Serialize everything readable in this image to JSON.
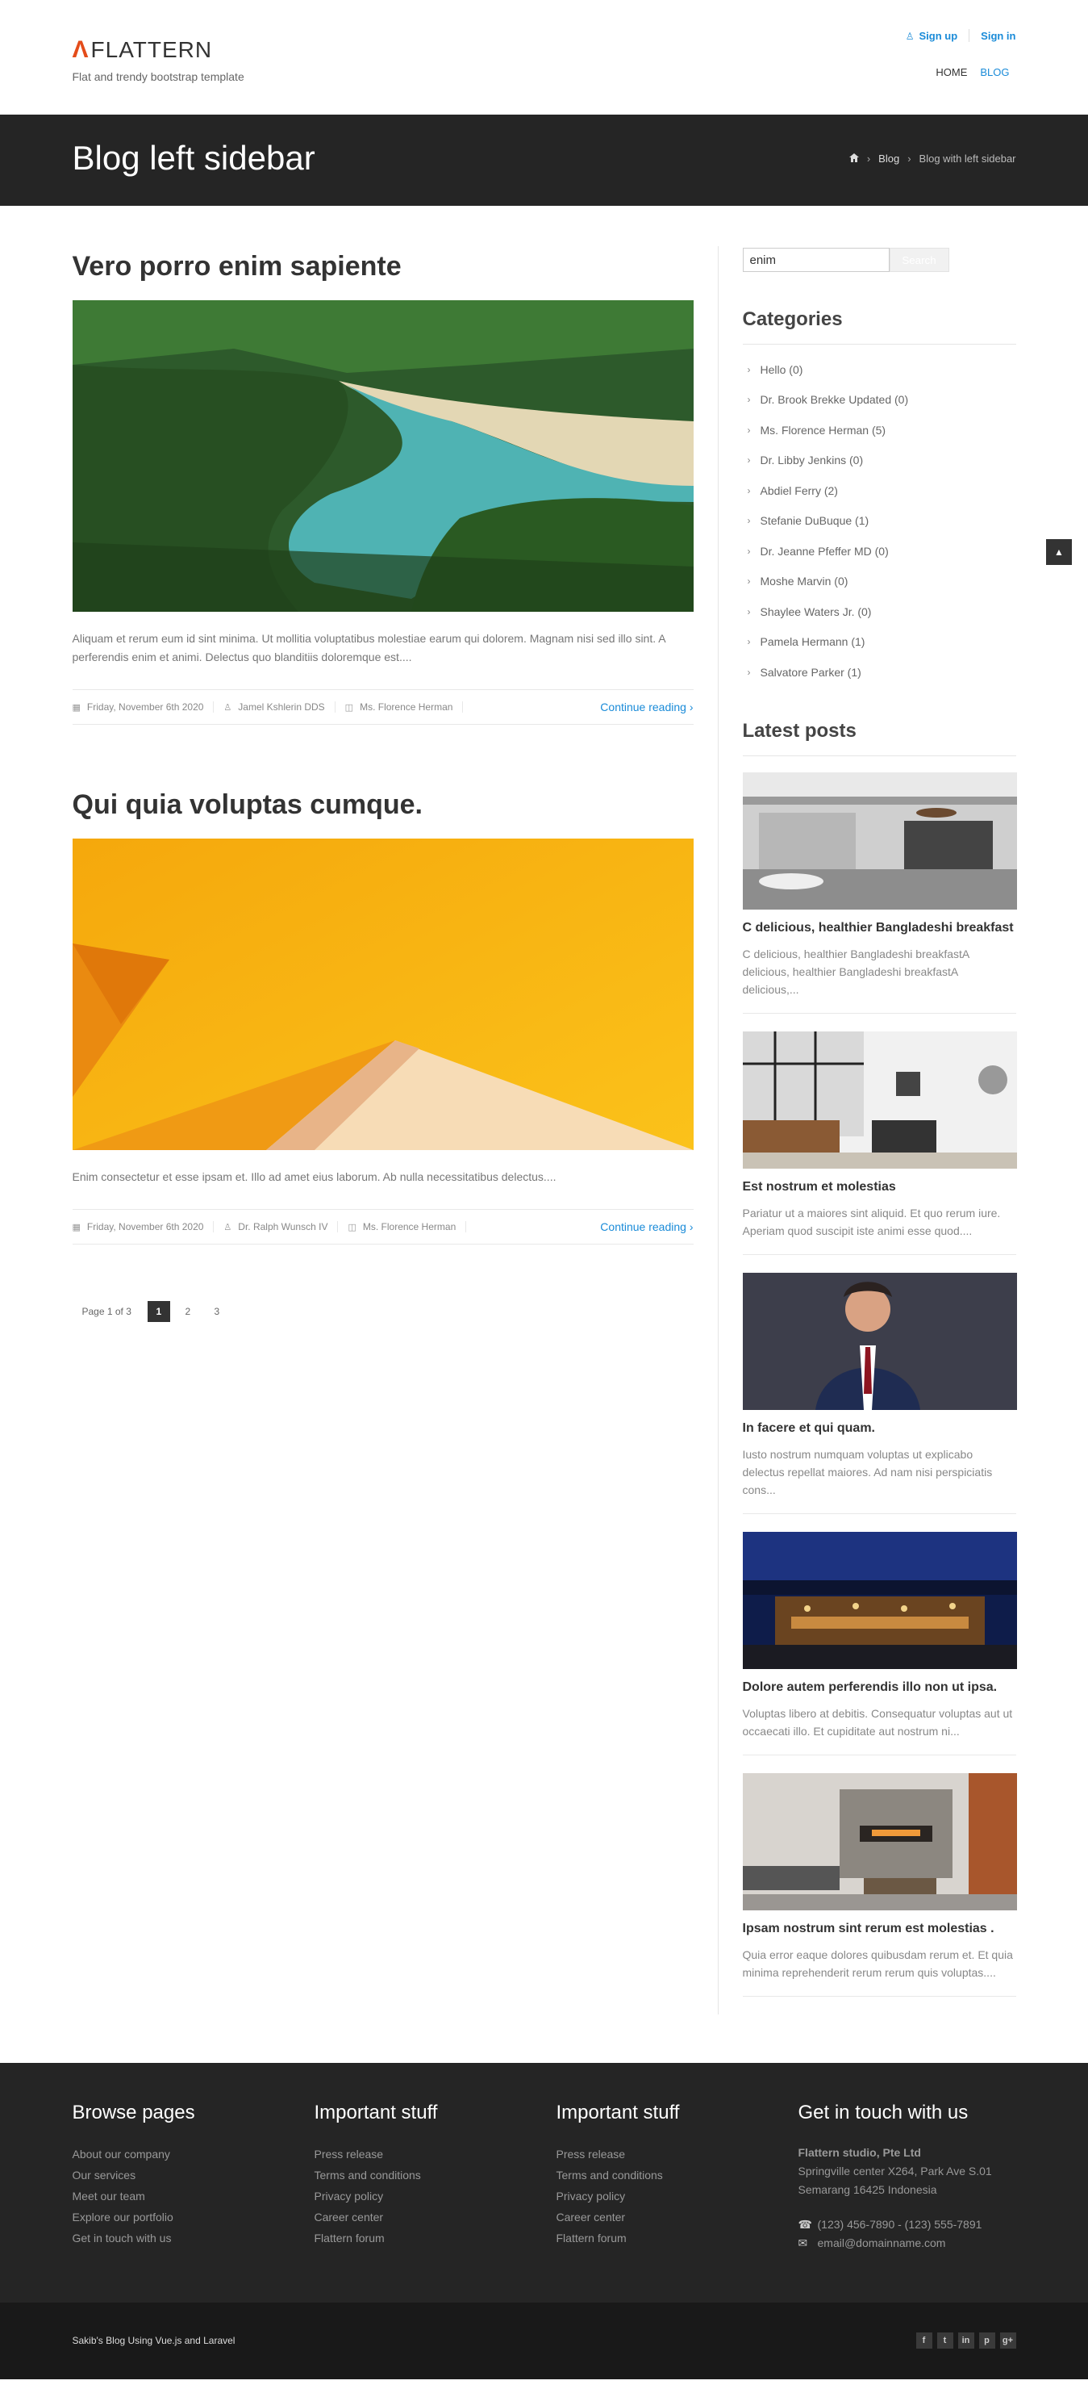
{
  "brand": {
    "name": "FLATTERN",
    "logo_letter": "Λ",
    "tagline": "Flat and trendy bootstrap template"
  },
  "auth": {
    "signup": "Sign up",
    "signin": "Sign in"
  },
  "nav": {
    "home": "HOME",
    "blog": "BLOG"
  },
  "page": {
    "title": "Blog left sidebar"
  },
  "breadcrumb": {
    "home_icon": "home-icon",
    "blog": "Blog",
    "current": "Blog with left sidebar"
  },
  "posts": [
    {
      "title": "Vero porro enim sapiente",
      "excerpt": "Aliquam et rerum eum id sint minima. Ut mollitia voluptatibus molestiae earum qui dolorem. Magnam nisi sed illo sint. A perferendis enim et animi. Delectus quo blanditiis doloremque est....",
      "date": "Friday, November 6th 2020",
      "author": "Jamel Kshlerin DDS",
      "category": "Ms. Florence Herman",
      "more": "Continue reading"
    },
    {
      "title": "Qui quia voluptas cumque.",
      "excerpt": "Enim consectetur et esse ipsam et. Illo ad amet eius laborum. Ab nulla necessitatibus delectus....",
      "date": "Friday, November 6th 2020",
      "author": "Dr. Ralph Wunsch IV",
      "category": "Ms. Florence Herman",
      "more": "Continue reading"
    }
  ],
  "pagination": {
    "label": "Page 1 of 3",
    "pages": [
      "1",
      "2",
      "3"
    ]
  },
  "search": {
    "value": "enim",
    "button": "Search"
  },
  "categories": {
    "title": "Categories",
    "items": [
      "Hello (0)",
      "Dr. Brook Brekke Updated (0)",
      "Ms. Florence Herman (5)",
      "Dr. Libby Jenkins (0)",
      "Abdiel Ferry (2)",
      "Stefanie DuBuque (1)",
      "Dr. Jeanne Pfeffer MD (0)",
      "Moshe Marvin (0)",
      "Shaylee Waters Jr. (0)",
      "Pamela Hermann (1)",
      "Salvatore Parker (1)"
    ]
  },
  "latest": {
    "title": "Latest posts",
    "items": [
      {
        "title": "C delicious, healthier Bangladeshi breakfast",
        "excerpt": "C delicious, healthier Bangladeshi breakfastA delicious, healthier Bangladeshi breakfastA delicious,..."
      },
      {
        "title": "Est nostrum et molestias",
        "excerpt": "Pariatur ut a maiores sint aliquid. Et quo rerum iure. Aperiam quod suscipit iste animi esse quod...."
      },
      {
        "title": "In facere et qui quam.",
        "excerpt": "Iusto nostrum numquam voluptas ut explicabo delectus repellat maiores. Ad nam nisi perspiciatis cons..."
      },
      {
        "title": "Dolore autem perferendis illo non ut ipsa.",
        "excerpt": "Voluptas libero at debitis. Consequatur voluptas aut ut occaecati illo. Et cupiditate aut nostrum ni..."
      },
      {
        "title": "Ipsam nostrum sint rerum est molestias .",
        "excerpt": "Quia error eaque dolores quibusdam rerum et. Et quia minima reprehenderit rerum rerum quis voluptas...."
      }
    ]
  },
  "footer": {
    "browse": {
      "title": "Browse pages",
      "links": [
        "About our company",
        "Our services",
        "Meet our team",
        "Explore our portfolio",
        "Get in touch with us"
      ]
    },
    "important1": {
      "title": "Important stuff",
      "links": [
        "Press release",
        "Terms and conditions",
        "Privacy policy",
        "Career center",
        "Flattern forum"
      ]
    },
    "important2": {
      "title": "Important stuff",
      "links": [
        "Press release",
        "Terms and conditions",
        "Privacy policy",
        "Career center",
        "Flattern forum"
      ]
    },
    "contact": {
      "title": "Get in touch with us",
      "company": "Flattern studio, Pte Ltd",
      "address1": "Springville center X264, Park Ave S.01",
      "address2": "Semarang 16425 Indonesia",
      "phone": "(123) 456-7890 - (123) 555-7891",
      "email": "email@domainname.com"
    }
  },
  "bottom": {
    "copy": "Sakib's Blog Using Vue.js and Laravel",
    "social": [
      "f",
      "t",
      "in",
      "p",
      "g+"
    ]
  },
  "colors": {
    "accent": "#1a8bd8",
    "logo": "#e44c1a",
    "dark": "#252525",
    "darker": "#191919"
  }
}
